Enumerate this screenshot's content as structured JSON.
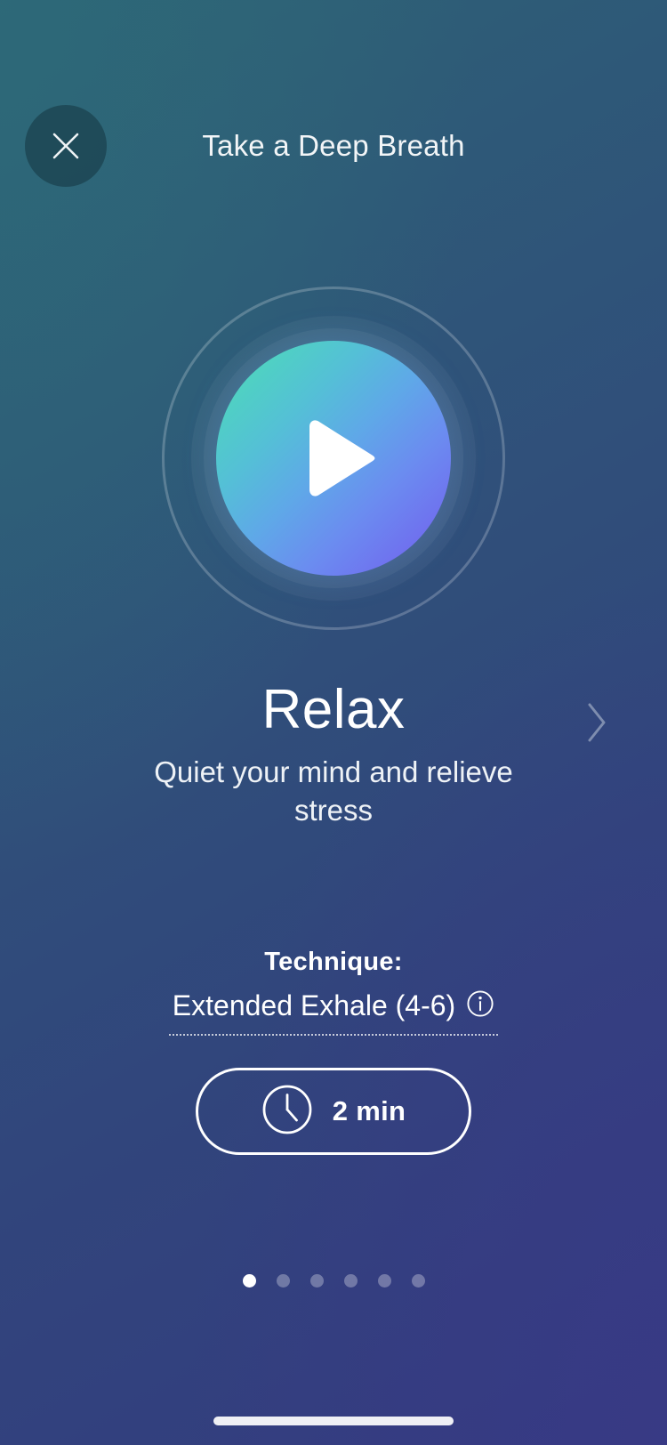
{
  "header": {
    "title": "Take a Deep Breath",
    "close_icon": "close-icon"
  },
  "player": {
    "play_icon": "play-icon",
    "next_icon": "chevron-right-icon"
  },
  "session": {
    "title": "Relax",
    "subtitle": "Quiet your mind and relieve stress"
  },
  "technique": {
    "label": "Technique:",
    "value": "Extended Exhale (4-6)",
    "info_icon": "info-icon"
  },
  "duration": {
    "clock_icon": "clock-icon",
    "value": "2 min"
  },
  "pagination": {
    "total": 6,
    "active_index": 0
  },
  "colors": {
    "background_start": "#2d6375",
    "background_mid": "#31457c",
    "background_end": "#343b80",
    "accent_teal": "#52dcb6",
    "accent_purple": "#6d5fe8",
    "text_primary": "#ffffff"
  }
}
